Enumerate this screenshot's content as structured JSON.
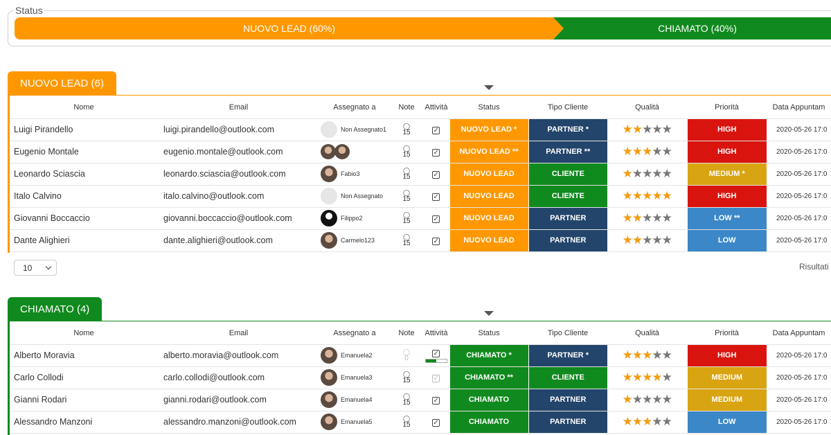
{
  "status": {
    "legend": "Status",
    "segments": [
      {
        "label": "NUOVO LEAD (60%)",
        "percent": 60,
        "color": "#ff9800"
      },
      {
        "label": "CHIAMATO (40%)",
        "percent": 40,
        "color": "#108a1e"
      }
    ]
  },
  "columns": [
    "Nome",
    "Email",
    "Assegnato a",
    "Note",
    "Attività",
    "Status",
    "Tipo Cliente",
    "Qualità",
    "Priorità",
    "Data Appuntam"
  ],
  "colors": {
    "orange": "#ff9800",
    "green": "#108a1e",
    "navy": "#23456b",
    "red": "#d9140f",
    "gold": "#d9a412",
    "blue": "#3b87c8"
  },
  "groups": [
    {
      "title": "NUOVO LEAD (6)",
      "color": "#ff9800",
      "rows": [
        {
          "name": "Luigi Pirandello",
          "email": "luigi.pirandello@outlook.com",
          "assigned": "Non Assegnato1",
          "avatar": "empty",
          "note_count": "15",
          "activity_checked": true,
          "status": "NUOVO LEAD *",
          "tipo": "PARTNER *",
          "tipo_color": "#23456b",
          "rating": 2,
          "priority": "HIGH",
          "priority_color": "#d9140f",
          "date": "2020-05-26 17:0"
        },
        {
          "name": "Eugenio Montale",
          "email": "eugenio.montale@outlook.com",
          "assigned": "",
          "avatar": "pair",
          "note_count": "15",
          "activity_checked": true,
          "status": "NUOVO LEAD **",
          "tipo": "PARTNER **",
          "tipo_color": "#23456b",
          "rating": 3,
          "priority": "HIGH",
          "priority_color": "#d9140f",
          "date": "2020-05-26 17:0"
        },
        {
          "name": "Leonardo Sciascia",
          "email": "leonardo.sciascia@outlook.com",
          "assigned": "Fabio3",
          "avatar": "photo",
          "note_count": "15",
          "activity_checked": true,
          "status": "NUOVO LEAD",
          "tipo": "CLIENTE",
          "tipo_color": "#108a1e",
          "rating": 1,
          "priority": "MEDIUM *",
          "priority_color": "#d9a412",
          "date": "2020-05-26 17:0"
        },
        {
          "name": "Italo Calvino",
          "email": "italo.calvino@outlook.com",
          "assigned": "Non Assegnato",
          "avatar": "empty",
          "note_count": "15",
          "activity_checked": true,
          "status": "NUOVO LEAD",
          "tipo": "CLIENTE",
          "tipo_color": "#108a1e",
          "rating": 5,
          "priority": "HIGH",
          "priority_color": "#d9140f",
          "date": "2020-05-26 17:0"
        },
        {
          "name": "Giovanni Boccaccio",
          "email": "giovanni.boccaccio@outlook.com",
          "assigned": "Filippo2",
          "avatar": "dark",
          "note_count": "15",
          "activity_checked": true,
          "status": "NUOVO LEAD",
          "tipo": "PARTNER",
          "tipo_color": "#23456b",
          "rating": 2,
          "priority": "LOW **",
          "priority_color": "#3b87c8",
          "date": "2020-05-26 17:0"
        },
        {
          "name": "Dante Alighieri",
          "email": "dante.alighieri@outlook.com",
          "assigned": "Carmelo123",
          "avatar": "photo",
          "note_count": "15",
          "activity_checked": true,
          "status": "NUOVO LEAD",
          "tipo": "PARTNER",
          "tipo_color": "#23456b",
          "rating": 2,
          "priority": "LOW",
          "priority_color": "#3b87c8",
          "date": "2020-05-26 17:0"
        }
      ]
    },
    {
      "title": "CHIAMATO (4)",
      "color": "#108a1e",
      "rows": [
        {
          "name": "Alberto Moravia",
          "email": "alberto.moravia@outlook.com",
          "assigned": "Emanuela2",
          "avatar": "photo",
          "note_count": "0",
          "note_muted": true,
          "activity_checked": true,
          "progress": 0.5,
          "status": "CHIAMATO *",
          "tipo": "PARTNER *",
          "tipo_color": "#23456b",
          "rating": 3,
          "priority": "HIGH",
          "priority_color": "#d9140f",
          "date": "2020-05-26 17:0"
        },
        {
          "name": "Carlo Collodi",
          "email": "carlo.collodi@outlook.com",
          "assigned": "Emanuela3",
          "avatar": "photo",
          "note_count": "15",
          "activity_checked": true,
          "activity_muted": true,
          "status": "CHIAMATO **",
          "tipo": "CLIENTE",
          "tipo_color": "#108a1e",
          "rating": 4,
          "priority": "MEDIUM",
          "priority_color": "#d9a412",
          "date": "2020-05-26 17:0"
        },
        {
          "name": "Gianni Rodari",
          "email": "gianni.rodari@outlook.com",
          "assigned": "Emanuela4",
          "avatar": "photo",
          "note_count": "15",
          "activity_checked": true,
          "status": "CHIAMATO",
          "tipo": "PARTNER",
          "tipo_color": "#23456b",
          "rating": 1,
          "priority": "MEDIUM",
          "priority_color": "#d9a412",
          "date": "2020-05-26 17:0"
        },
        {
          "name": "Alessandro Manzoni",
          "email": "alessandro.manzoni@outlook.com",
          "assigned": "Emanuela5",
          "avatar": "photo",
          "note_count": "15",
          "activity_checked": true,
          "status": "CHIAMATO",
          "tipo": "PARTNER",
          "tipo_color": "#23456b",
          "rating": 3,
          "priority": "LOW",
          "priority_color": "#3b87c8",
          "date": "2020-05-26 17:0"
        }
      ]
    }
  ],
  "pager": {
    "page_size": "10",
    "results_label": "Risultati"
  }
}
